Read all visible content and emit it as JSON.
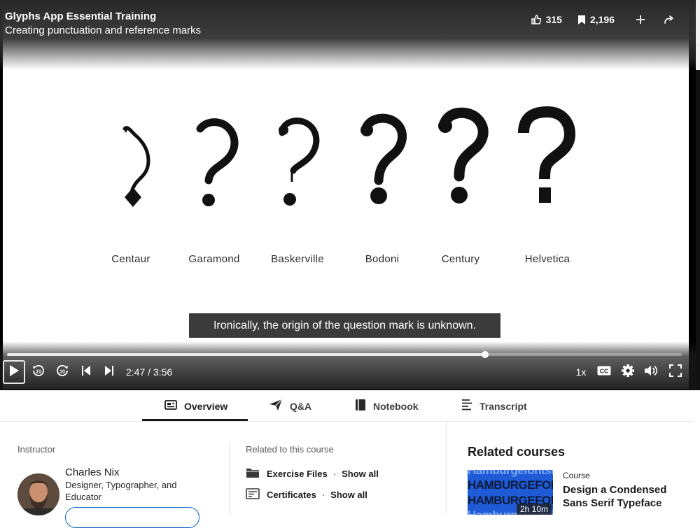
{
  "video": {
    "course_title": "Glyphs App Essential Training",
    "lesson_title": "Creating punctuation and reference marks",
    "likes": "315",
    "saves": "2,196",
    "caption": "Ironically, the origin of the question mark is unknown.",
    "specimens": [
      "Centaur",
      "Garamond",
      "Baskerville",
      "Bodoni",
      "Century",
      "Helvetica"
    ],
    "progress_fraction": 0.708,
    "time": "2:47 / 3:56",
    "speed": "1x",
    "icons": {
      "like": "thumbs-up-icon",
      "save": "bookmark-icon",
      "add": "plus-icon",
      "share": "share-arrow-icon",
      "play": "play-icon",
      "rewind": "rewind-10-icon",
      "forward": "forward-10-icon",
      "prev": "skip-previous-icon",
      "next": "skip-next-icon",
      "cc": "closed-captions-icon",
      "settings": "gear-icon",
      "volume": "volume-icon",
      "fullscreen": "fullscreen-icon"
    }
  },
  "tabs": [
    {
      "label": "Overview",
      "icon": "overview-icon",
      "active": true
    },
    {
      "label": "Q&A",
      "icon": "paper-plane-icon",
      "active": false
    },
    {
      "label": "Notebook",
      "icon": "notebook-icon",
      "active": false
    },
    {
      "label": "Transcript",
      "icon": "transcript-icon",
      "active": false
    }
  ],
  "instructor": {
    "section_label": "Instructor",
    "name": "Charles Nix",
    "role": "Designer, Typographer, and Educator"
  },
  "related_resources": {
    "section_label": "Related to this course",
    "items": [
      {
        "label": "Exercise Files",
        "link": "Show all",
        "icon": "folder-icon"
      },
      {
        "label": "Certificates",
        "link": "Show all",
        "icon": "certificate-icon"
      }
    ],
    "separator": "·"
  },
  "related_courses": {
    "title": "Related courses",
    "items": [
      {
        "type": "Course",
        "title": "Design a Condensed Sans Serif Typeface",
        "duration": "2h 10m",
        "thumb_lines": [
          "Hamburgefontsiv",
          "HAMBURGEFONTSIV",
          "HAMBURGEFONTSIV",
          "Hamburgefontsiv"
        ]
      }
    ]
  },
  "colors": {
    "accent": "#0a66c2",
    "thumb_bg": "#1f5bd6",
    "caption_bg": "#3b3b3b"
  }
}
